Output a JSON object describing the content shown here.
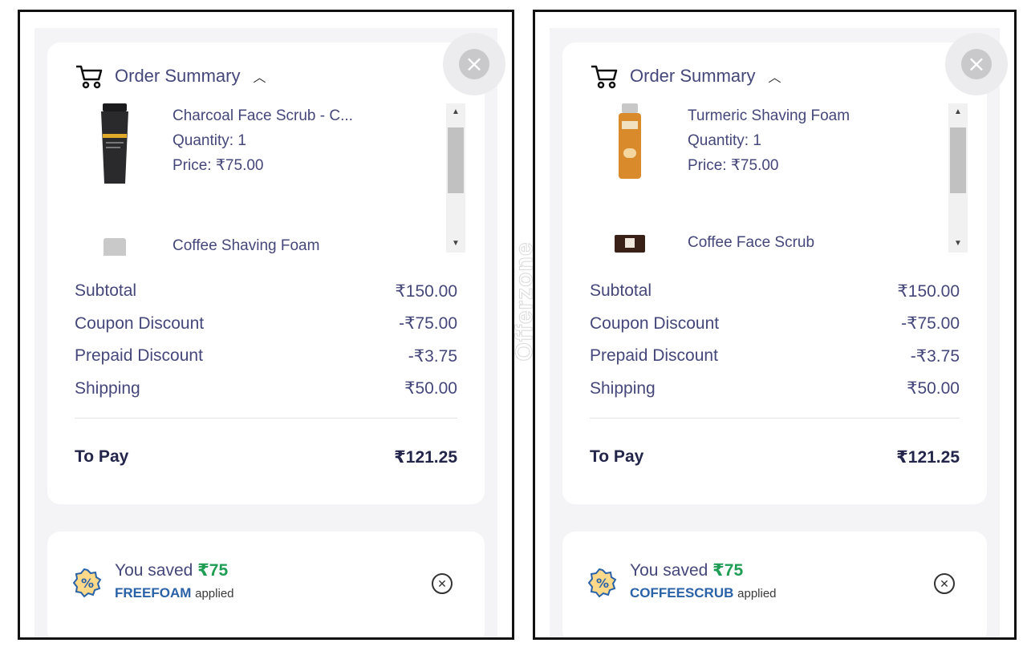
{
  "watermark": "Offerzone",
  "screens": [
    {
      "header_title": "Order Summary",
      "items": [
        {
          "name": "Charcoal Face Scrub - C...",
          "quantity": "Quantity: 1",
          "price": "Price: ₹75.00",
          "product_color": "#2a2a2c"
        },
        {
          "name": "Coffee Shaving Foam",
          "quantity": "",
          "price": "",
          "product_color": "#bdbdbd"
        }
      ],
      "totals": {
        "subtotal_label": "Subtotal",
        "subtotal_value": "₹150.00",
        "coupon_label": "Coupon Discount",
        "coupon_value": "-₹75.00",
        "prepaid_label": "Prepaid Discount",
        "prepaid_value": "-₹3.75",
        "shipping_label": "Shipping",
        "shipping_value": "₹50.00",
        "topay_label": "To Pay",
        "topay_value": "₹121.25"
      },
      "coupon": {
        "saved_text": "You saved",
        "saved_amount": "₹75",
        "code": "FREEFOAM",
        "applied_text": "applied"
      }
    },
    {
      "header_title": "Order Summary",
      "items": [
        {
          "name": "Turmeric Shaving Foam",
          "quantity": "Quantity: 1",
          "price": "Price: ₹75.00",
          "product_color": "#d98a2b"
        },
        {
          "name": "Coffee Face Scrub",
          "quantity": "",
          "price": "",
          "product_color": "#3a2118"
        }
      ],
      "totals": {
        "subtotal_label": "Subtotal",
        "subtotal_value": "₹150.00",
        "coupon_label": "Coupon Discount",
        "coupon_value": "-₹75.00",
        "prepaid_label": "Prepaid Discount",
        "prepaid_value": "-₹3.75",
        "shipping_label": "Shipping",
        "shipping_value": "₹50.00",
        "topay_label": "To Pay",
        "topay_value": "₹121.25"
      },
      "coupon": {
        "saved_text": "You saved",
        "saved_amount": "₹75",
        "code": "COFFEESCRUB",
        "applied_text": "applied"
      }
    }
  ],
  "colors": {
    "coupon_code": "#2a62a8",
    "saved_amount": "#1f9d55",
    "text": "#45477a",
    "panel_bg": "#f4f4f6"
  }
}
